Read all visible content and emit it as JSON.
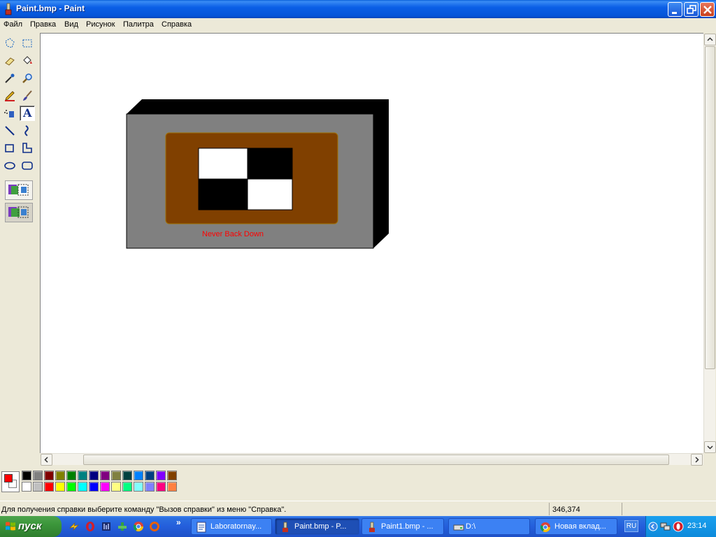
{
  "window": {
    "title": "Paint.bmp - Paint"
  },
  "menu": [
    "Файл",
    "Правка",
    "Вид",
    "Рисунок",
    "Палитра",
    "Справка"
  ],
  "tools": [
    {
      "name": "free-form-select-icon"
    },
    {
      "name": "rect-select-icon"
    },
    {
      "name": "eraser-icon"
    },
    {
      "name": "fill-bucket-icon"
    },
    {
      "name": "color-picker-icon"
    },
    {
      "name": "magnifier-icon"
    },
    {
      "name": "pencil-icon"
    },
    {
      "name": "brush-icon"
    },
    {
      "name": "airbrush-icon"
    },
    {
      "name": "text-tool-icon",
      "selected": true,
      "glyph": "A"
    },
    {
      "name": "line-icon"
    },
    {
      "name": "curve-icon"
    },
    {
      "name": "rectangle-icon"
    },
    {
      "name": "polygon-icon"
    },
    {
      "name": "ellipse-icon"
    },
    {
      "name": "rounded-rect-icon"
    }
  ],
  "canvas": {
    "text_on_image": "Never Back Down",
    "colors": {
      "front": "#808080",
      "top_side": "#000000",
      "inner_panel": "#804000",
      "text": "#ff0000"
    }
  },
  "palette": {
    "foreground": "#ff0000",
    "background": "#ffffff",
    "row1": [
      "#000000",
      "#808080",
      "#800000",
      "#808000",
      "#008000",
      "#008080",
      "#000080",
      "#800080",
      "#808040",
      "#004040",
      "#0080ff",
      "#004080",
      "#8000ff",
      "#804000"
    ],
    "row2": [
      "#ffffff",
      "#c0c0c0",
      "#ff0000",
      "#ffff00",
      "#00ff00",
      "#00ffff",
      "#0000ff",
      "#ff00ff",
      "#ffff80",
      "#00ff80",
      "#80ffff",
      "#8080ff",
      "#ff0080",
      "#ff8040"
    ]
  },
  "status": {
    "help": "Для получения справки выберите команду \"Вызов справки\" из меню \"Справка\".",
    "coords": "346,374"
  },
  "taskbar": {
    "start_label": "пуск",
    "overflow": "»",
    "tasks": [
      {
        "label": "Laboratornay...",
        "icon": "word-doc-icon"
      },
      {
        "label": "Paint.bmp - P...",
        "icon": "paint-icon",
        "active": true
      },
      {
        "label": "Paint1.bmp - ...",
        "icon": "paint-icon"
      },
      {
        "label": "D:\\",
        "icon": "drive-icon"
      },
      {
        "label": "Новая вклад...",
        "icon": "chrome-icon"
      }
    ],
    "language": "RU",
    "clock": "23:14"
  }
}
